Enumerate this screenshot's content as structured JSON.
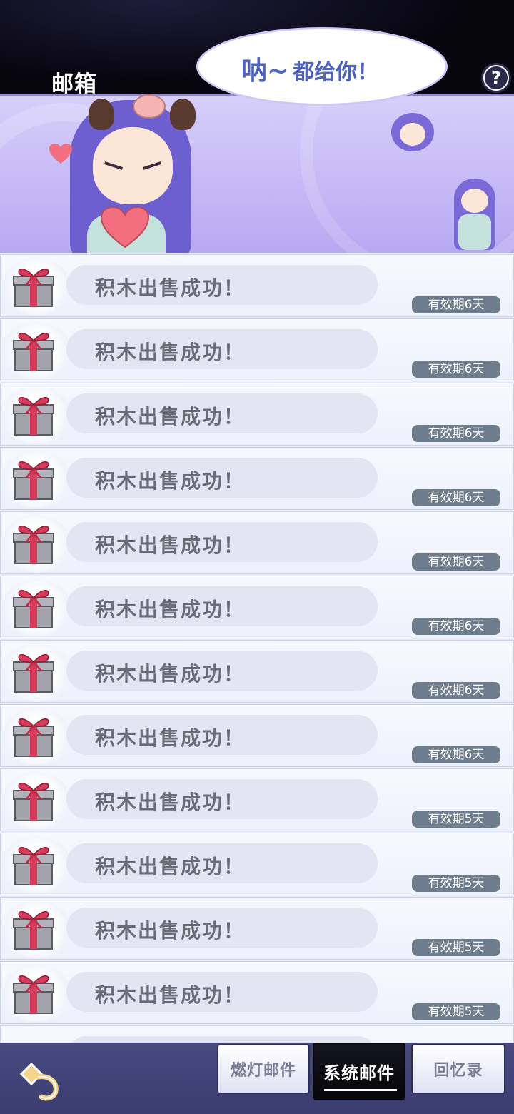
{
  "header": {
    "title": "邮箱",
    "help_label": "?"
  },
  "banner": {
    "speech_main": "呐~",
    "speech_sub": "都给你！"
  },
  "mails": [
    {
      "title": "积木出售成功！",
      "expiry": "有效期6天"
    },
    {
      "title": "积木出售成功！",
      "expiry": "有效期6天"
    },
    {
      "title": "积木出售成功！",
      "expiry": "有效期6天"
    },
    {
      "title": "积木出售成功！",
      "expiry": "有效期6天"
    },
    {
      "title": "积木出售成功！",
      "expiry": "有效期6天"
    },
    {
      "title": "积木出售成功！",
      "expiry": "有效期6天"
    },
    {
      "title": "积木出售成功！",
      "expiry": "有效期6天"
    },
    {
      "title": "积木出售成功！",
      "expiry": "有效期6天"
    },
    {
      "title": "积木出售成功！",
      "expiry": "有效期5天"
    },
    {
      "title": "积木出售成功！",
      "expiry": "有效期5天"
    },
    {
      "title": "积木出售成功！",
      "expiry": "有效期5天"
    },
    {
      "title": "积木出售成功！",
      "expiry": "有效期5天"
    }
  ],
  "tabs": [
    {
      "label": "燃灯邮件",
      "active": false
    },
    {
      "label": "系统邮件",
      "active": true
    },
    {
      "label": "回忆录",
      "active": false
    }
  ],
  "colors": {
    "accent": "#4d62c2",
    "gift_box": "#9a9aa2",
    "gift_ribbon": "#d83a5a",
    "expiry_badge": "#6e7d8d",
    "bottom_bar": "#484a80"
  },
  "icons": {
    "help": "question-mark-icon",
    "gift": "gift-box-icon",
    "back": "back-arrow-icon"
  }
}
